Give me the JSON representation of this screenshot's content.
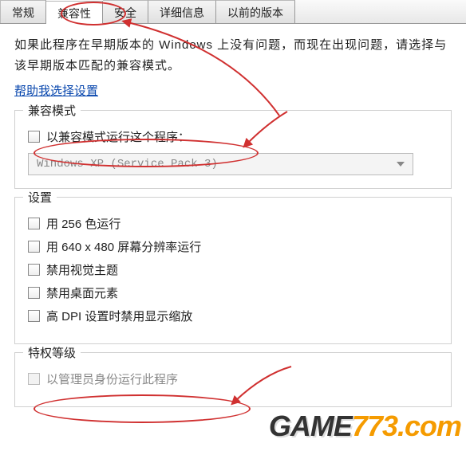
{
  "tabs": {
    "t0": "常规",
    "t1": "兼容性",
    "t2": "安全",
    "t3": "详细信息",
    "t4": "以前的版本"
  },
  "intro": "如果此程序在早期版本的 Windows 上没有问题，而现在出现问题，请选择与该早期版本匹配的兼容模式。",
  "help_link": "帮助我选择设置",
  "group_compat": {
    "title": "兼容模式",
    "cb_run": "以兼容模式运行这个程序：",
    "dropdown": "Windows XP (Service Pack 3)"
  },
  "group_settings": {
    "title": "设置",
    "cb_256": "用 256 色运行",
    "cb_640": "用 640 x 480 屏幕分辨率运行",
    "cb_theme": "禁用视觉主题",
    "cb_desktop": "禁用桌面元素",
    "cb_dpi": "高 DPI 设置时禁用显示缩放"
  },
  "group_priv": {
    "title": "特权等级",
    "cb_admin": "以管理员身份运行此程序"
  },
  "watermark": {
    "a": "GAME",
    "b": "773.com"
  }
}
